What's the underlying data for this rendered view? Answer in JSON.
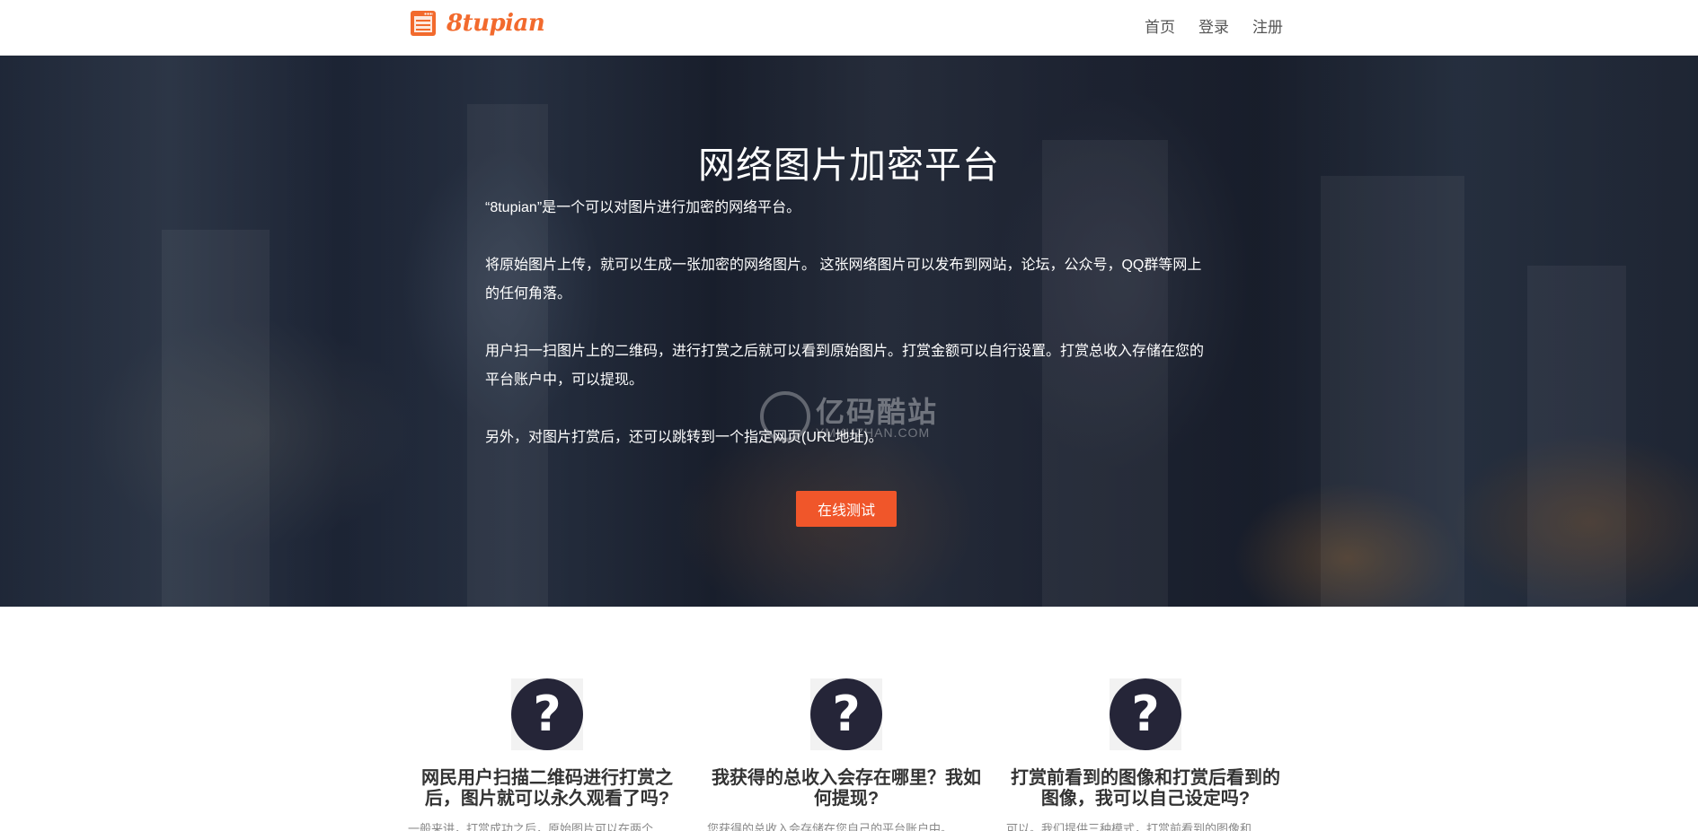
{
  "header": {
    "logo_text": "8tupian",
    "nav": [
      "首页",
      "登录",
      "注册"
    ]
  },
  "hero": {
    "title": "网络图片加密平台",
    "paragraphs": [
      "“8tupian”是一个可以对图片进行加密的网络平台。",
      "将原始图片上传，就可以生成一张加密的网络图片。 这张网络图片可以发布到网站，论坛，公众号，QQ群等网上的任何角落。",
      "用户扫一扫图片上的二维码，进行打赏之后就可以看到原始图片。打赏金额可以自行设置。打赏总收入存储在您的平台账户中，可以提现。",
      "另外，对图片打赏后，还可以跳转到一个指定网页(URL地址)。"
    ],
    "cta_label": "在线测试",
    "watermark": {
      "big": "亿码酷站",
      "small": "YMKUZHAN.COM"
    }
  },
  "features": [
    {
      "icon": "question-icon",
      "title": "网民用户扫描二维码进行打赏之后，图片就可以永久观看了吗?",
      "desc": "一般来讲，打赏成功之后，原始图片可以在两个"
    },
    {
      "icon": "question-icon",
      "title": "我获得的总收入会存在哪里？我如何提现?",
      "desc": "您获得的总收入会存储在您自己的平台账户中。"
    },
    {
      "icon": "question-icon",
      "title": "打赏前看到的图像和打赏后看到的图像，我可以自己设定吗?",
      "desc": "可以。我们提供三种模式，打赏前看到的图像和"
    }
  ],
  "colors": {
    "accent": "#f26a2d",
    "button": "#f0562a",
    "icon_bg": "#252538"
  }
}
